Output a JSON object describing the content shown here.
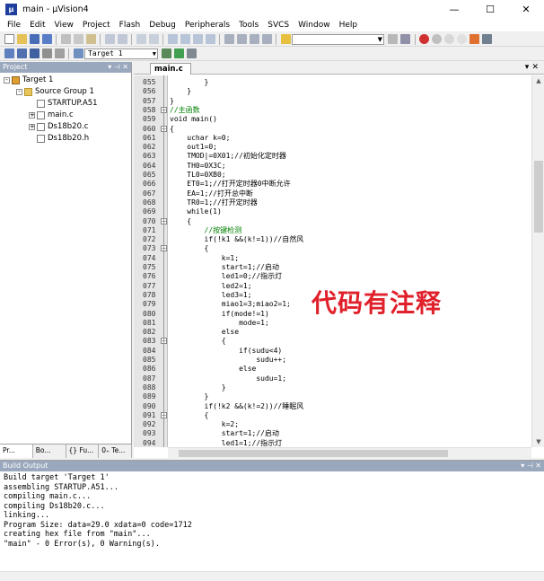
{
  "window": {
    "title": "main - µVision4"
  },
  "menu": [
    "File",
    "Edit",
    "View",
    "Project",
    "Flash",
    "Debug",
    "Peripherals",
    "Tools",
    "SVCS",
    "Window",
    "Help"
  ],
  "toolbar": {
    "target": "Target 1"
  },
  "project_panel": {
    "title": "Project",
    "tree": [
      {
        "label": "Target 1",
        "depth": 0,
        "icon": "target-icon",
        "expand": "-"
      },
      {
        "label": "Source Group 1",
        "depth": 1,
        "icon": "folder-icon",
        "expand": "-"
      },
      {
        "label": "STARTUP.A51",
        "depth": 2,
        "icon": "file-icon",
        "expand": ""
      },
      {
        "label": "main.c",
        "depth": 2,
        "icon": "file-icon",
        "expand": "+"
      },
      {
        "label": "Ds18b20.c",
        "depth": 2,
        "icon": "file-icon",
        "expand": "+"
      },
      {
        "label": "Ds18b20.h",
        "depth": 2,
        "icon": "file-icon",
        "expand": ""
      }
    ],
    "tabs": [
      "Pr...",
      "Bo...",
      "{} Fu...",
      "0₊ Te..."
    ]
  },
  "editor": {
    "tab": "main.c",
    "lines": [
      {
        "n": "055",
        "t": "        }",
        "c": "#000"
      },
      {
        "n": "056",
        "t": "    }",
        "c": "#000"
      },
      {
        "n": "057",
        "t": "}",
        "c": "#000"
      },
      {
        "n": "058",
        "t": "//主函数",
        "c": "#008000"
      },
      {
        "n": "059",
        "t": "void main()",
        "c": "#000"
      },
      {
        "n": "060",
        "t": "{",
        "c": "#000"
      },
      {
        "n": "061",
        "t": "    uchar k=0;",
        "c": "#000"
      },
      {
        "n": "062",
        "t": "    out1=0;",
        "c": "#000"
      },
      {
        "n": "063",
        "t": "    TMOD|=0X01;//初始化定时器",
        "c": "#000"
      },
      {
        "n": "064",
        "t": "    TH0=0X3C;",
        "c": "#000"
      },
      {
        "n": "065",
        "t": "    TL0=0XB0;",
        "c": "#000"
      },
      {
        "n": "066",
        "t": "    ET0=1;//打开定时器0中断允许",
        "c": "#000"
      },
      {
        "n": "067",
        "t": "    EA=1;//打开总中断",
        "c": "#000"
      },
      {
        "n": "068",
        "t": "    TR0=1;//打开定时器",
        "c": "#000"
      },
      {
        "n": "069",
        "t": "    while(1)",
        "c": "#000"
      },
      {
        "n": "070",
        "t": "    {",
        "c": "#000"
      },
      {
        "n": "071",
        "t": "        //按键检测",
        "c": "#008000"
      },
      {
        "n": "072",
        "t": "        if(!k1 &&(k!=1))//自然风",
        "c": "#000"
      },
      {
        "n": "073",
        "t": "        {",
        "c": "#000"
      },
      {
        "n": "074",
        "t": "            k=1;",
        "c": "#000"
      },
      {
        "n": "075",
        "t": "            start=1;//启动",
        "c": "#000"
      },
      {
        "n": "076",
        "t": "            led1=0;//指示灯",
        "c": "#000"
      },
      {
        "n": "077",
        "t": "            led2=1;",
        "c": "#000"
      },
      {
        "n": "078",
        "t": "            led3=1;",
        "c": "#000"
      },
      {
        "n": "079",
        "t": "            miao1=3;miao2=1;",
        "c": "#000"
      },
      {
        "n": "080",
        "t": "            if(mode!=1)",
        "c": "#000"
      },
      {
        "n": "081",
        "t": "                mode=1;",
        "c": "#000"
      },
      {
        "n": "082",
        "t": "            else",
        "c": "#000"
      },
      {
        "n": "083",
        "t": "            {",
        "c": "#000"
      },
      {
        "n": "084",
        "t": "                if(sudu<4)",
        "c": "#000"
      },
      {
        "n": "085",
        "t": "                    sudu++;",
        "c": "#000"
      },
      {
        "n": "086",
        "t": "                else",
        "c": "#000"
      },
      {
        "n": "087",
        "t": "                    sudu=1;",
        "c": "#000"
      },
      {
        "n": "088",
        "t": "            }",
        "c": "#000"
      },
      {
        "n": "089",
        "t": "        }",
        "c": "#000"
      },
      {
        "n": "090",
        "t": "        if(!k2 &&(k!=2))//睡眠风",
        "c": "#000"
      },
      {
        "n": "091",
        "t": "        {",
        "c": "#000"
      },
      {
        "n": "092",
        "t": "            k=2;",
        "c": "#000"
      },
      {
        "n": "093",
        "t": "            start=1;//启动",
        "c": "#000"
      },
      {
        "n": "094",
        "t": "            led1=1;//指示灯",
        "c": "#000"
      }
    ],
    "overlay": "代码有注释"
  },
  "build_output": {
    "title": "Build Output",
    "lines": [
      "Build target 'Target 1'",
      "assembling STARTUP.A51...",
      "compiling main.c...",
      "compiling Ds18b20.c...",
      "linking...",
      "Program Size: data=29.0 xdata=0 code=1712",
      "creating hex file from \"main\"...",
      "\"main\" - 0 Error(s), 0 Warning(s)."
    ]
  }
}
